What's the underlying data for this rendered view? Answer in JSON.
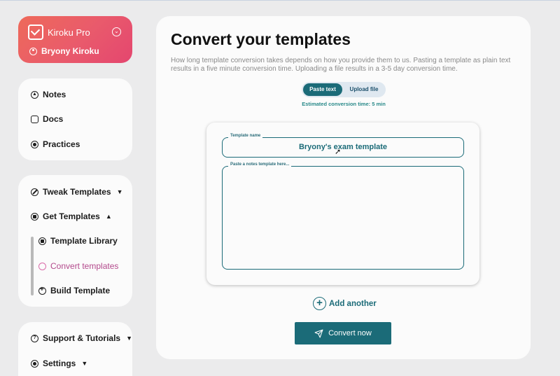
{
  "account": {
    "app_name": "Kiroku Pro",
    "user_name": "Bryony Kiroku"
  },
  "nav_primary": [
    {
      "label": "Notes",
      "icon": "compass-icon"
    },
    {
      "label": "Docs",
      "icon": "chat-icon"
    },
    {
      "label": "Practices",
      "icon": "plus-circle-icon"
    }
  ],
  "nav_templates": {
    "tweak": "Tweak Templates",
    "get": "Get Templates",
    "sub": [
      "Template Library",
      "Convert templates",
      "Build Template"
    ]
  },
  "nav_support": {
    "support": "Support & Tutorials",
    "settings": "Settings"
  },
  "main": {
    "title": "Convert your templates",
    "description": "How long template conversion takes depends on how you provide them to us. Pasting a template as plain text results in a five minute conversion time. Uploading a file results in a 3-5 day conversion time.",
    "toggle": {
      "paste": "Paste text",
      "upload": "Upload file"
    },
    "estimate": "Estimated conversion time: 5 min",
    "form": {
      "name_label": "Template name",
      "name_value": "Bryony's exam template",
      "notes_label": "Paste a notes template here..."
    },
    "add_another": "Add another",
    "convert": "Convert now"
  },
  "colors": {
    "accent": "#1b6b78",
    "active": "#b34a8c",
    "account_start": "#ee6a5a",
    "account_end": "#e4466f"
  }
}
